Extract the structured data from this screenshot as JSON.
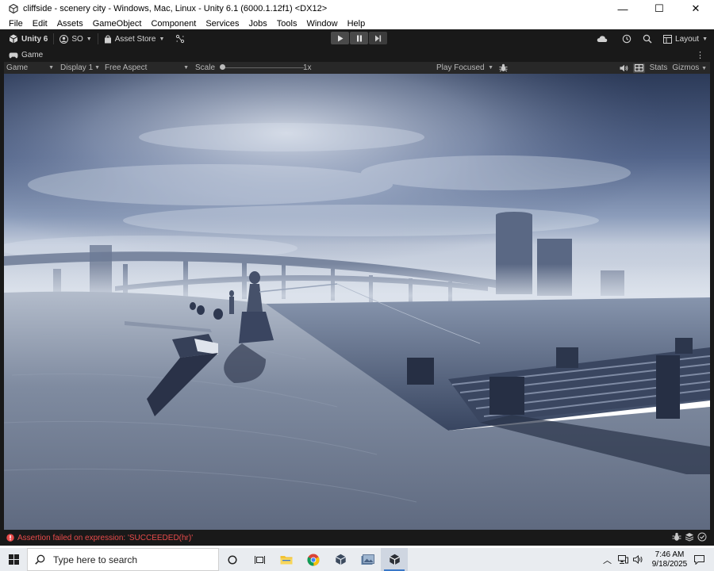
{
  "window": {
    "title": "cliffside - scenery city - Windows, Mac, Linux - Unity 6.1 (6000.1.12f1) <DX12>",
    "minimize": "—",
    "maximize": "☐",
    "close": "✕"
  },
  "menu": [
    "File",
    "Edit",
    "Assets",
    "GameObject",
    "Component",
    "Services",
    "Jobs",
    "Tools",
    "Window",
    "Help"
  ],
  "toolbar": {
    "unity_label": "Unity 6",
    "account_label": "SO",
    "asset_store_label": "Asset Store",
    "layout_label": "Layout"
  },
  "tab": {
    "game_label": "Game"
  },
  "game_controls": {
    "mode": "Game",
    "display": "Display 1",
    "aspect": "Free Aspect",
    "scale_label": "Scale",
    "scale_value": "1x",
    "play_mode": "Play Focused",
    "stats_label": "Stats",
    "gizmos_label": "Gizmos"
  },
  "status": {
    "error_message": "Assertion failed on expression: 'SUCCEEDED(hr)'"
  },
  "taskbar": {
    "search_placeholder": "Type here to search",
    "time": "7:46 AM",
    "date": "9/18/2025"
  },
  "colors": {
    "editor_bg": "#191919",
    "controls_bg": "#282828",
    "error": "#e94b4b",
    "taskbar": "#e9ecf0"
  }
}
